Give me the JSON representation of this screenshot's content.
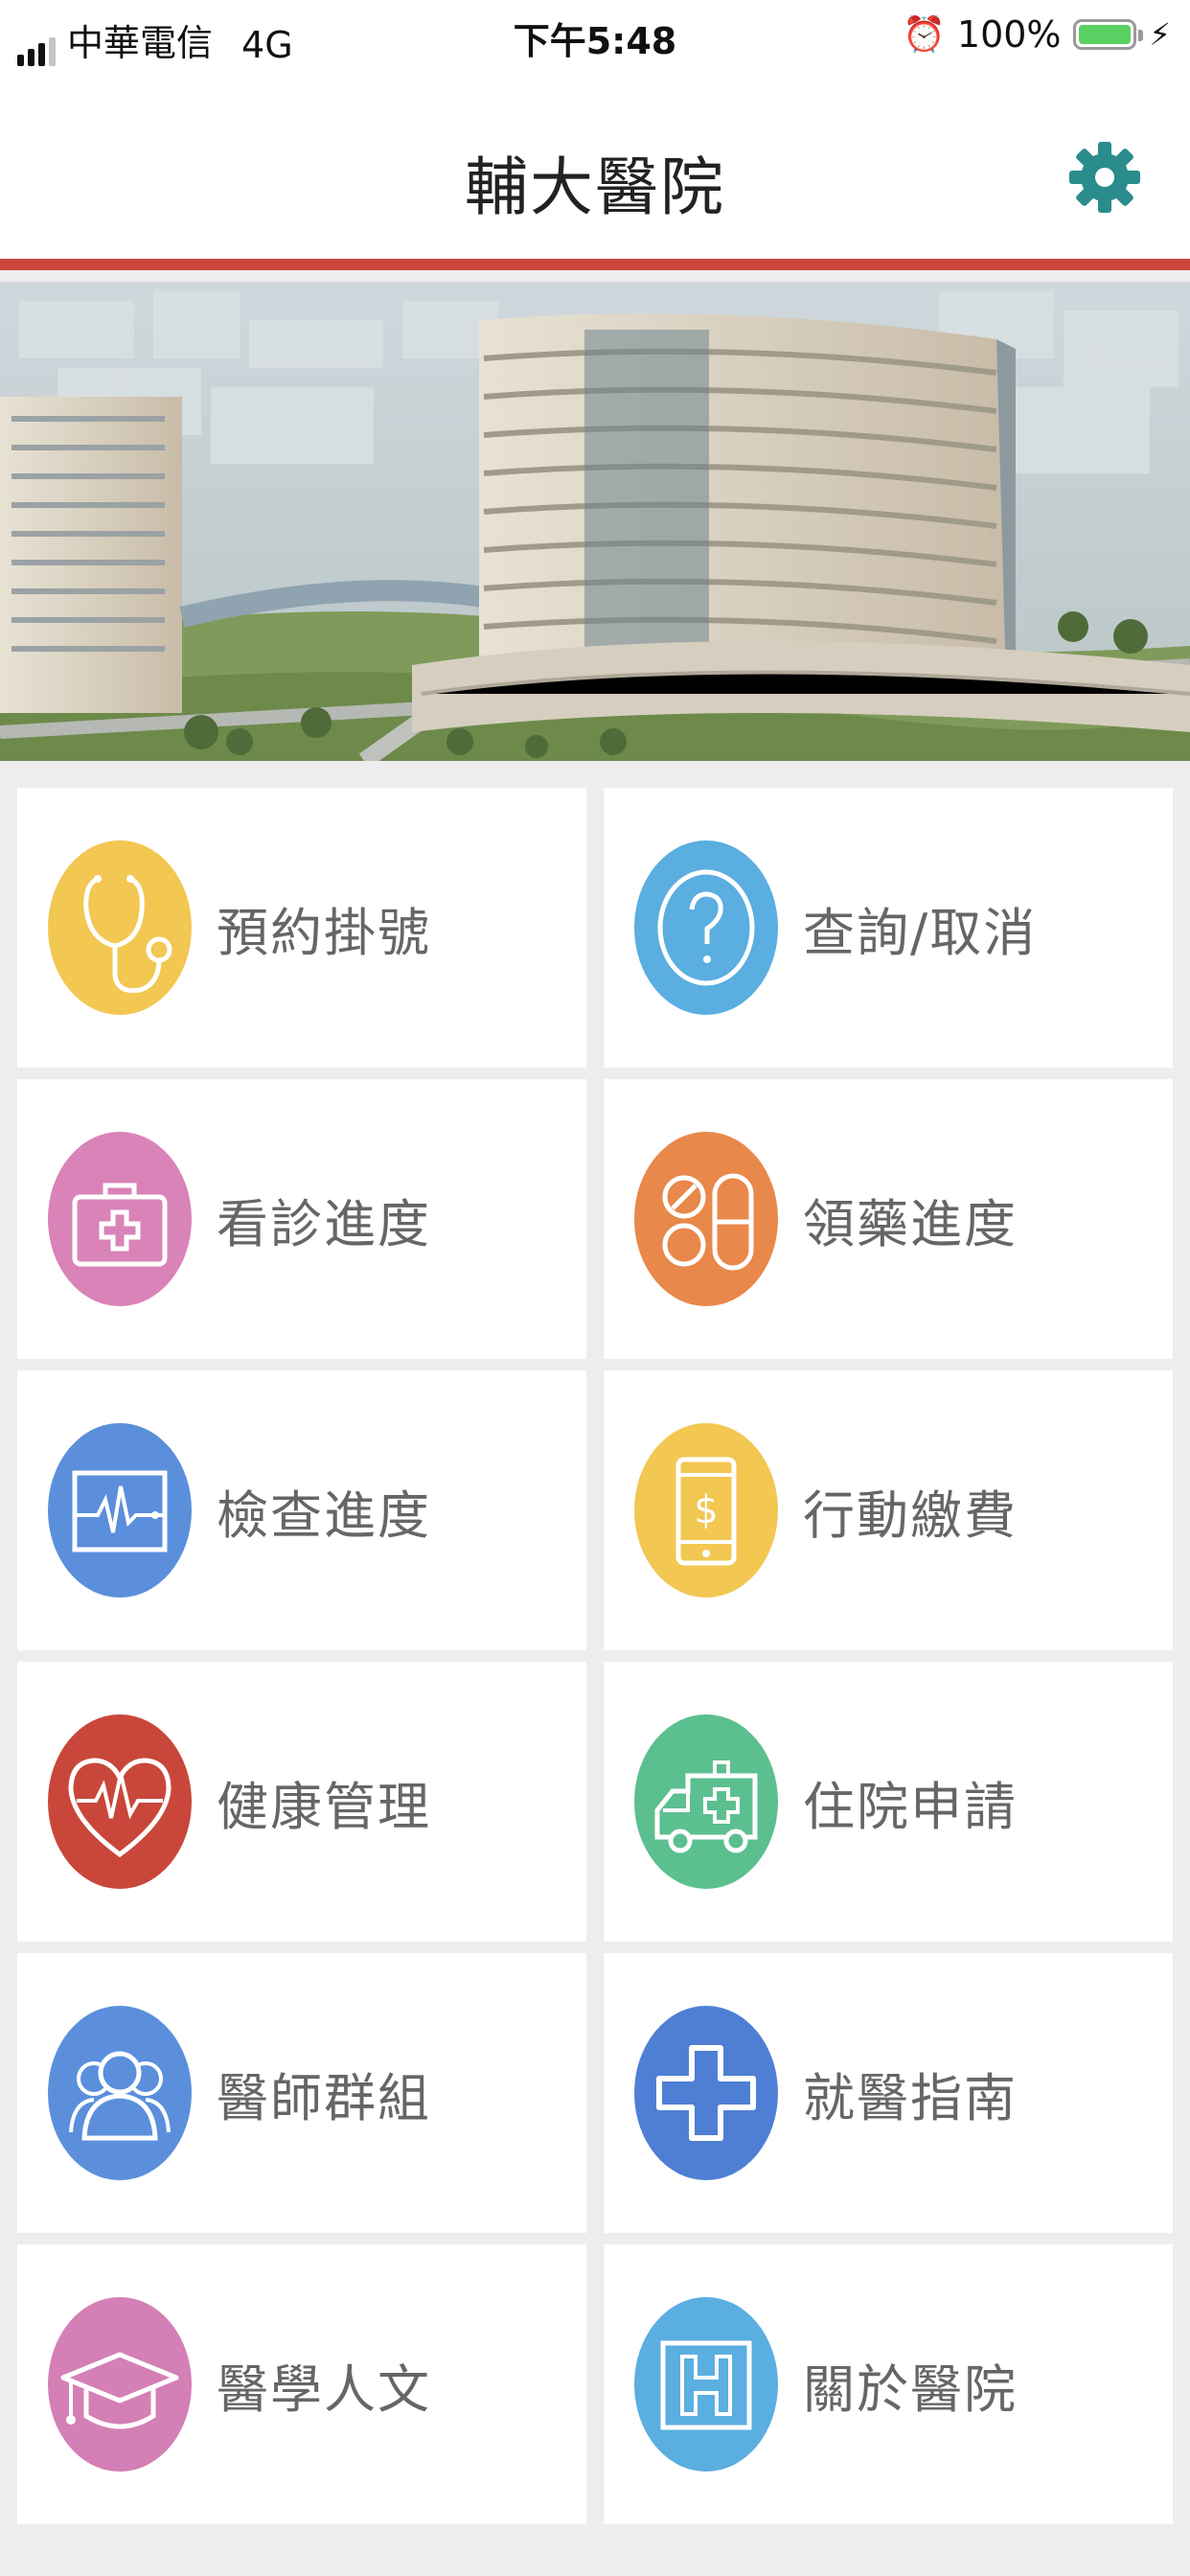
{
  "status_bar": {
    "carrier": "中華電信",
    "network": "4G",
    "time": "下午5:48",
    "battery": "100%",
    "battery_level": 1.0
  },
  "header": {
    "title": "輔大醫院",
    "settings_icon": "gear-icon",
    "accent_color": "#c9473a",
    "settings_color": "#2a8c8c"
  },
  "banner": {
    "image": "hospital-building-rendering"
  },
  "menu": [
    {
      "label": "預約掛號",
      "icon": "stethoscope-icon",
      "color": "#f2c752"
    },
    {
      "label": "查詢/取消",
      "icon": "question-icon",
      "color": "#5aaee0"
    },
    {
      "label": "看診進度",
      "icon": "medical-kit-icon",
      "color": "#d983b8"
    },
    {
      "label": "領藥進度",
      "icon": "pills-icon",
      "color": "#e8884a"
    },
    {
      "label": "檢查進度",
      "icon": "ekg-monitor-icon",
      "color": "#5b8fdc"
    },
    {
      "label": "行動繳費",
      "icon": "mobile-payment-icon",
      "color": "#f2c752"
    },
    {
      "label": "健康管理",
      "icon": "heart-rate-icon",
      "color": "#c9473a"
    },
    {
      "label": "住院申請",
      "icon": "ambulance-icon",
      "color": "#5cbf8f"
    },
    {
      "label": "醫師群組",
      "icon": "doctor-group-icon",
      "color": "#5b8fdc"
    },
    {
      "label": "就醫指南",
      "icon": "medical-cross-icon",
      "color": "#4f7fd4"
    },
    {
      "label": "醫學人文",
      "icon": "graduation-cap-icon",
      "color": "#d47fb5"
    },
    {
      "label": "關於醫院",
      "icon": "hospital-h-icon",
      "color": "#5aaee0"
    }
  ]
}
